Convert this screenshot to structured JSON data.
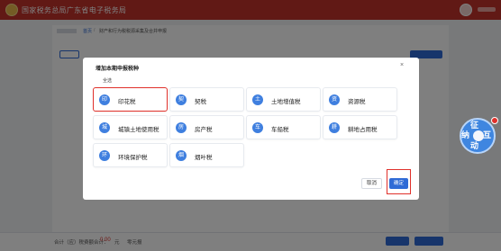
{
  "app": {
    "title": "国家税务总局广东省电子税务局"
  },
  "breadcrumb": {
    "home": "首页",
    "separator": "/",
    "current": "财产和行为税税源采集及合并申报"
  },
  "footer": {
    "tax_total_label": "合计（应）税费额合计：",
    "tax_total_value": "0.00",
    "tax_total_unit": "元",
    "extra": "零元报"
  },
  "widget": {
    "chars": [
      "征",
      "纳",
      "互",
      "动"
    ]
  },
  "modal": {
    "title": "增加本期申报税种",
    "close": "×",
    "select_all": "全选",
    "taxes": [
      {
        "label": "印花税",
        "icon": "stamp-tax-icon",
        "glyph": "印"
      },
      {
        "label": "契税",
        "icon": "deed-tax-icon",
        "glyph": "契"
      },
      {
        "label": "土地增值税",
        "icon": "land-value-tax-icon",
        "glyph": "土"
      },
      {
        "label": "资源税",
        "icon": "resource-tax-icon",
        "glyph": "资"
      },
      {
        "label": "城镇土地使用税",
        "icon": "urban-land-tax-icon",
        "glyph": "城"
      },
      {
        "label": "房产税",
        "icon": "property-tax-icon",
        "glyph": "房"
      },
      {
        "label": "车船税",
        "icon": "vehicle-tax-icon",
        "glyph": "车"
      },
      {
        "label": "耕地占用税",
        "icon": "farmland-tax-icon",
        "glyph": "耕"
      },
      {
        "label": "环境保护税",
        "icon": "environment-tax-icon",
        "glyph": "环"
      },
      {
        "label": "烟叶税",
        "icon": "tobacco-tax-icon",
        "glyph": "烟"
      }
    ],
    "cancel": "取消",
    "confirm": "确定"
  },
  "colors": {
    "header": "#c2322b",
    "primary": "#2f6bd6",
    "highlight": "#e0312b"
  }
}
